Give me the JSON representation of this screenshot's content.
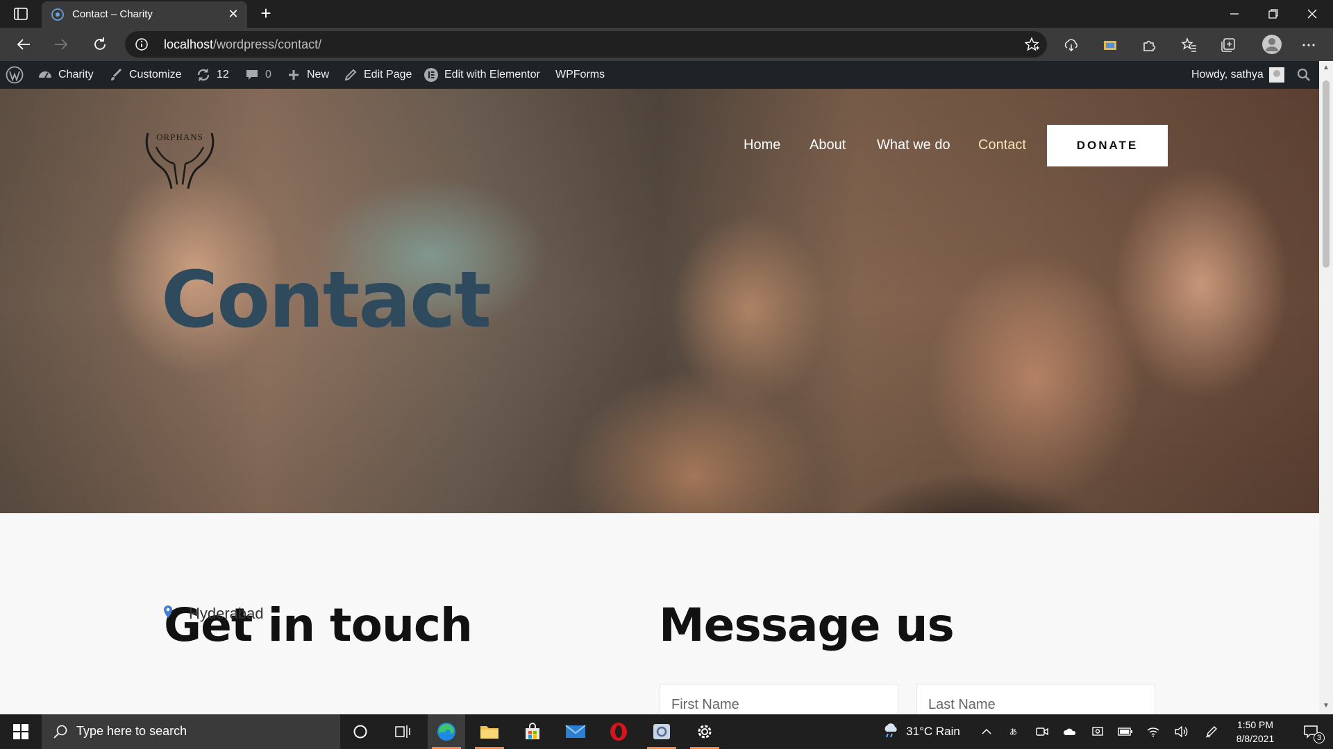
{
  "browser": {
    "tab_title": "Contact – Charity",
    "url_host": "localhost",
    "url_path": "/wordpress/contact/"
  },
  "adminbar": {
    "site_name": "Charity",
    "customize": "Customize",
    "updates_count": "12",
    "comments_count": "0",
    "new": "New",
    "edit_page": "Edit Page",
    "edit_elementor": "Edit with Elementor",
    "wpforms": "WPForms",
    "howdy": "Howdy, sathya"
  },
  "site": {
    "logo_text": "ORPHANS",
    "nav": [
      "Home",
      "About",
      "What we do",
      "Contact"
    ],
    "active_nav": "Contact",
    "donate": "DONATE",
    "hero_title": "Contact"
  },
  "contact": {
    "get_in_touch": "Get in touch",
    "location": "Hyderabad",
    "message_us": "Message us",
    "first_name_placeholder": "First Name",
    "last_name_placeholder": "Last Name"
  },
  "taskbar": {
    "search_placeholder": "Type here to search",
    "weather": "31°C  Rain",
    "time": "1:50 PM",
    "date": "8/8/2021",
    "notification_count": "3"
  },
  "colors": {
    "admin_bar": "#1d2327",
    "hero_title": "#2f4a5c",
    "active_nav": "#f6e3b8",
    "taskbar_accent": "#f08c52"
  }
}
